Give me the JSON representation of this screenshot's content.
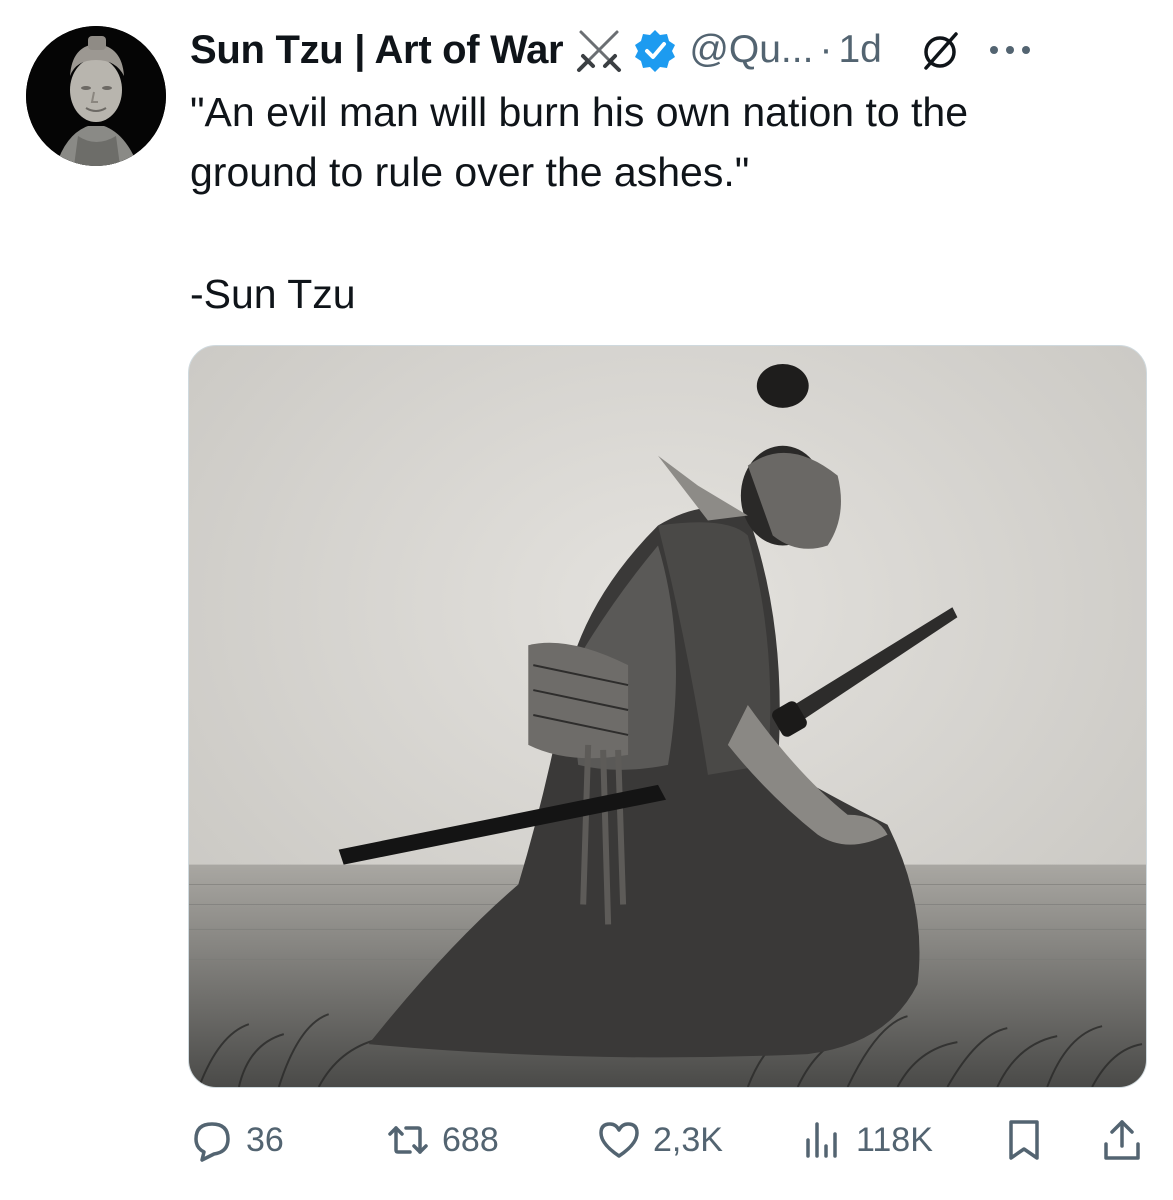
{
  "author": {
    "display_name": "Sun Tzu | Art of War",
    "handle": "@Qu...",
    "separator": "·",
    "time": "1d",
    "emoji_icon": "crossed-swords-icon",
    "verified_color": "#1d9bf0"
  },
  "tweet": {
    "lines": [
      "\"An evil man will burn his own nation to the",
      "ground to rule over the ashes.\""
    ],
    "signature": "-Sun Tzu"
  },
  "media": {
    "description_icon": "kneeling-samurai-illustration"
  },
  "actions": {
    "replies": "36",
    "retweets": "688",
    "likes": "2,3K",
    "views": "118K"
  },
  "colors": {
    "text": "#0f1419",
    "secondary": "#536471",
    "accent": "#1d9bf0"
  }
}
